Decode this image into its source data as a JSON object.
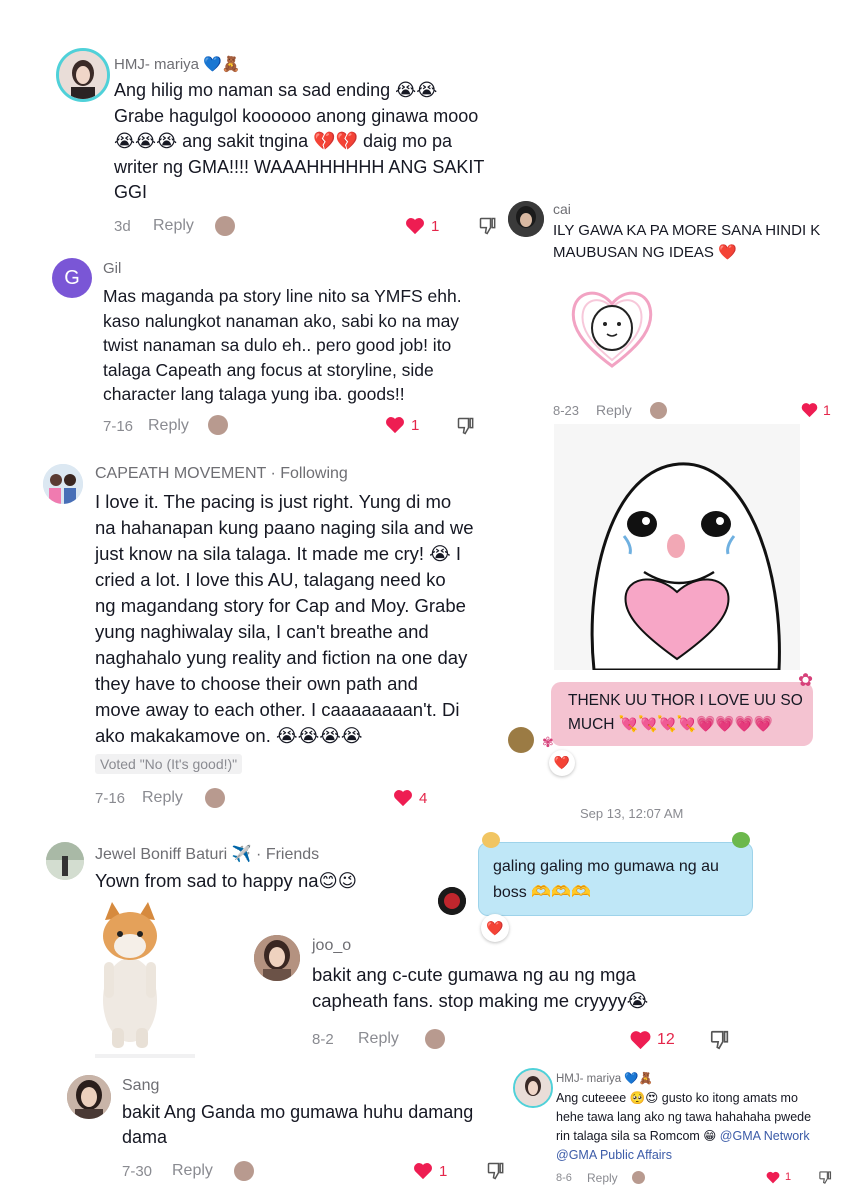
{
  "colors": {
    "heart": "#ee1d52",
    "text": "#161823",
    "meta": "#8a8b91",
    "pink_bubble": "#f4c3d1",
    "blue_bubble": "#bfe7f7",
    "link": "#3b5ba8"
  },
  "c1": {
    "username": "HMJ- mariya 💙🧸",
    "lines": [
      "Ang hilig mo naman sa sad ending 😭😭",
      "Grabe hagulgol koooooo anong ginawa mooo",
      "😭😭😭 ang sakit tngina 💔💔 daig mo pa",
      "writer ng GMA!!!! WAAAHHHHHH ANG SAKIT",
      "GGI"
    ],
    "date": "3d",
    "reply": "Reply",
    "likes": "1"
  },
  "c2": {
    "username": "Gil",
    "initial": "G",
    "lines": [
      "Mas maganda pa story line nito sa YMFS ehh.",
      "kaso nalungkot nanaman ako, sabi ko na may",
      "twist nanaman sa dulo eh.. pero good job! ito",
      "talaga Capeath ang focus at storyline, side",
      "character lang talaga yung iba. goods!!"
    ],
    "date": "7-16",
    "reply": "Reply",
    "likes": "1"
  },
  "c3": {
    "username": "CAPEATH MOVEMENT",
    "following": "· Following",
    "lines": [
      "I love it. The pacing is just right. Yung di mo",
      "na hahanapan kung paano naging sila and we",
      "just know na sila talaga. It made me cry! 😭 I",
      "cried a lot. I love this AU, talagang need ko",
      "ng magandang story for Cap and Moy. Grabe",
      "yung naghiwalay sila, I can't breathe and",
      "naghahalo yung reality and fiction na one day",
      "they have to choose their own path and",
      "move away to each other. I caaaaaaaan't. Di",
      "ako makakamove on. 😭😭😭😭"
    ],
    "voted": "Voted \"No (It's good!)\"",
    "date": "7-16",
    "reply": "Reply",
    "likes": "4"
  },
  "c4": {
    "username": "Jewel Boniff Baturi ✈️",
    "friends": "· Friends",
    "text": "Yown from sad to happy na😊😉"
  },
  "c5": {
    "username": "joo_o",
    "lines": [
      "bakit ang c-cute gumawa ng au ng mga",
      "capheath fans. stop making me cryyyy😭"
    ],
    "date": "8-2",
    "reply": "Reply",
    "likes": "12"
  },
  "c6": {
    "username": "Sang",
    "lines": [
      "bakit Ang Ganda mo gumawa huhu damang",
      "dama"
    ],
    "date": "7-30",
    "reply": "Reply",
    "likes": "1"
  },
  "r1": {
    "username": "cai",
    "lines": [
      "ILY GAWA KA PA MORE SANA HINDI K",
      "MAUBUSAN NG IDEAS ❤️"
    ],
    "date": "8-23",
    "reply": "Reply",
    "likes": "1"
  },
  "chat": {
    "pink_lines": [
      "THENK UU THOR I LOVE UU SO",
      "MUCH 💘💘💘💘💗💗💗💗"
    ],
    "reaction1": "❤️",
    "timestamp": "Sep 13, 12:07 AM",
    "blue_lines": [
      "galing galing mo gumawa ng au",
      "boss 🫶🫶🫶"
    ],
    "reaction2": "❤️"
  },
  "r2": {
    "username": "HMJ- mariya 💙🧸",
    "line1": "Ang cuteeee 🥺😍 gusto ko itong amats mo",
    "line2": "hehe tawa lang ako ng tawa hahahaha pwede",
    "line3a": "rin talaga sila sa Romcom 😁 ",
    "tag1": "@GMA Network",
    "tag2": "@GMA Public Affairs",
    "date": "8-6",
    "reply": "Reply",
    "likes": "1"
  }
}
